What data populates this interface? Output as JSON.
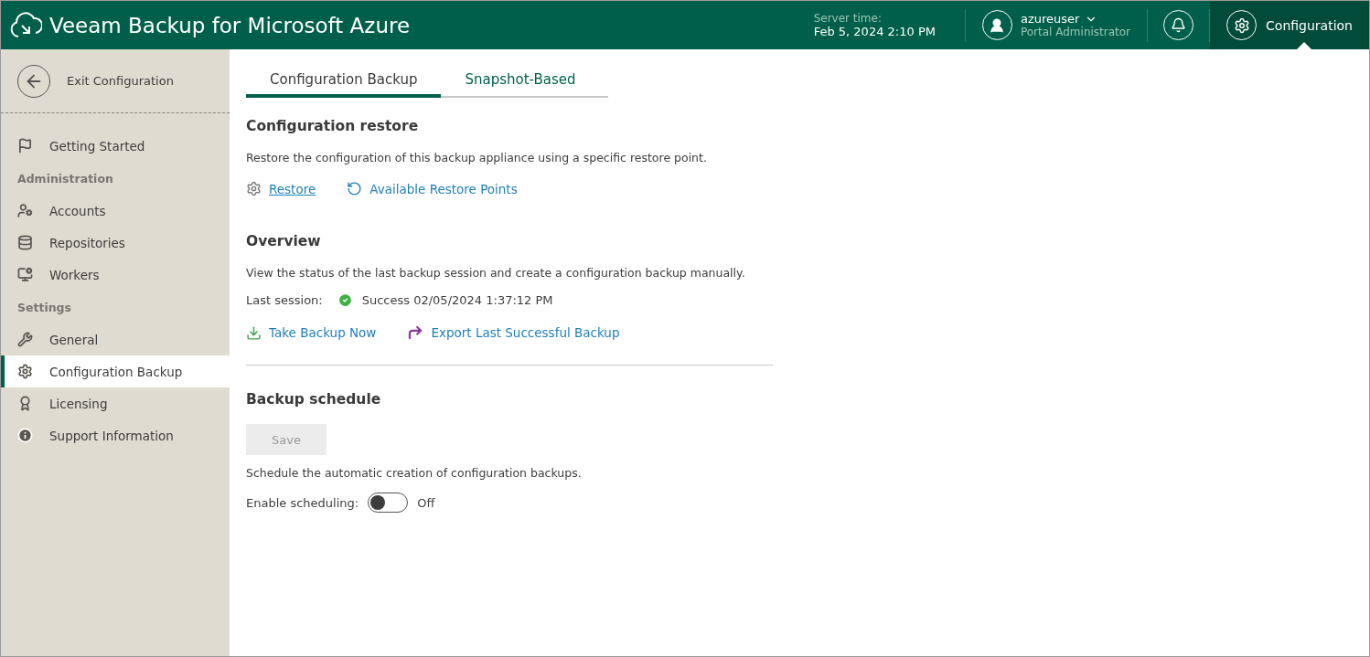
{
  "header": {
    "title": "Veeam Backup for Microsoft Azure",
    "server_time_label": "Server time:",
    "server_time": "Feb 5, 2024 2:10 PM",
    "user": {
      "name": "azureuser",
      "role": "Portal Administrator"
    },
    "configuration": {
      "label": "Configuration",
      "selected": true
    }
  },
  "sidebar": {
    "exit": "Exit Configuration",
    "items": [
      {
        "kind": "item",
        "label": "Getting Started",
        "selected": false
      },
      {
        "kind": "section",
        "label": "Administration"
      },
      {
        "kind": "item",
        "label": "Accounts",
        "selected": false
      },
      {
        "kind": "item",
        "label": "Repositories",
        "selected": false
      },
      {
        "kind": "item",
        "label": "Workers",
        "selected": false
      },
      {
        "kind": "section",
        "label": "Settings"
      },
      {
        "kind": "item",
        "label": "General",
        "selected": false
      },
      {
        "kind": "item",
        "label": "Configuration Backup",
        "selected": true
      },
      {
        "kind": "item",
        "label": "Licensing",
        "selected": false
      },
      {
        "kind": "item",
        "label": "Support Information",
        "selected": false
      }
    ]
  },
  "tabs": [
    {
      "label": "Configuration Backup",
      "selected": true
    },
    {
      "label": "Snapshot-Based",
      "selected": false
    }
  ],
  "restore": {
    "title": "Configuration restore",
    "description": "Restore the configuration of this backup appliance using a specific restore point.",
    "links": [
      "Restore",
      "Available Restore Points"
    ]
  },
  "overview": {
    "title": "Overview",
    "description": "View the status of the last backup session and create a configuration backup manually.",
    "last_session_label": "Last session:",
    "last_session_value": "Success 02/05/2024 1:37:12 PM",
    "links": [
      "Take Backup Now",
      "Export Last Successful Backup"
    ]
  },
  "schedule": {
    "title": "Backup schedule",
    "save": {
      "label": "Save",
      "disabled": true
    },
    "description": "Schedule the automatic creation of configuration backups.",
    "toggle_label": "Enable scheduling:",
    "toggle": {
      "on": false,
      "state_label": "Off"
    }
  }
}
